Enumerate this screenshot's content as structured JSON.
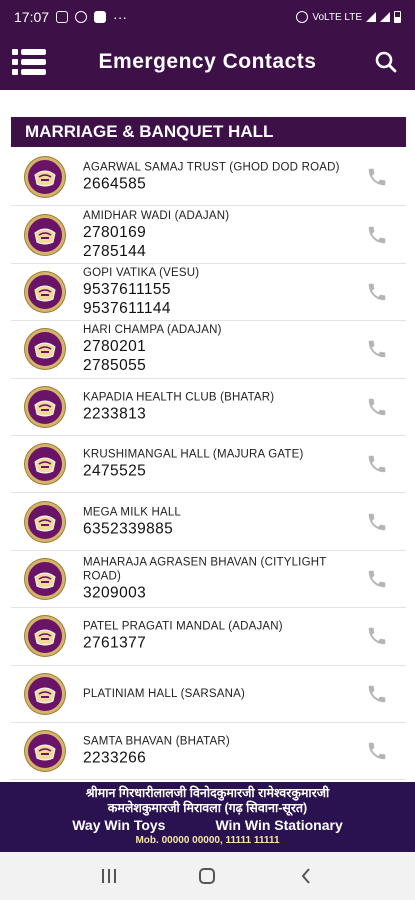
{
  "status_bar": {
    "time": "17:07",
    "dots": "···",
    "network": "VoLTE LTE"
  },
  "app_bar": {
    "title": "Emergency Contacts",
    "menu_icon": "menu-list-icon",
    "search_icon": "search-icon"
  },
  "section": {
    "title": "MARRIAGE & BANQUET HALL"
  },
  "contacts": [
    {
      "name": "AGARWAL SAMAJ TRUST (GHOD DOD ROAD)",
      "phone1": "2664585",
      "phone2": ""
    },
    {
      "name": "AMIDHAR WADI (ADAJAN)",
      "phone1": "2780169",
      "phone2": "2785144"
    },
    {
      "name": "GOPI VATIKA (VESU)",
      "phone1": "9537611155",
      "phone2": "9537611144"
    },
    {
      "name": "HARI CHAMPA (ADAJAN)",
      "phone1": "2780201",
      "phone2": "2785055"
    },
    {
      "name": "KAPADIA HEALTH CLUB (BHATAR)",
      "phone1": "2233813",
      "phone2": ""
    },
    {
      "name": "KRUSHIMANGAL HALL (MAJURA GATE)",
      "phone1": "2475525",
      "phone2": ""
    },
    {
      "name": "MEGA MILK HALL",
      "phone1": "6352339885",
      "phone2": ""
    },
    {
      "name": "MAHARAJA AGRASEN BHAVAN (CITYLIGHT ROAD)",
      "phone1": "3209003",
      "phone2": ""
    },
    {
      "name": "PATEL PRAGATI MANDAL (ADAJAN)",
      "phone1": "2761377",
      "phone2": ""
    },
    {
      "name": "PLATINIAM HALL (SARSANA)",
      "phone1": "",
      "phone2": ""
    },
    {
      "name": "SAMTA BHAVAN (BHATAR)",
      "phone1": "2233266",
      "phone2": ""
    }
  ],
  "banner": {
    "line1": "श्रीमान गिरधारीलालजी विनोदकुमारजी रामेश्वरकुमारजी",
    "line2": "कमलेशकुमारजी मिरावला (गढ़ सिवाना-सूरत)",
    "left_text": "Way Win Toys",
    "right_text": "Win Win Stationary",
    "mobile": "Mob. 00000 00000, 11111 11111"
  },
  "colors": {
    "primary": "#3d1048",
    "banner": "#2a1250",
    "phone_icon": "#b5b5b5"
  },
  "nav": {
    "recent_icon": "recent-apps-icon",
    "home_icon": "home-icon",
    "back_icon": "back-icon"
  }
}
